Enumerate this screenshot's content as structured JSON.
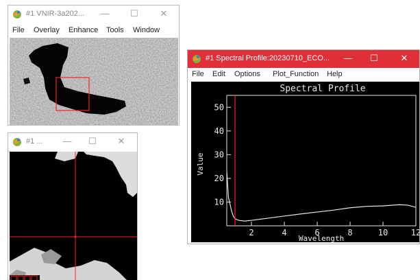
{
  "windows": {
    "image": {
      "title": "#1 VNIR-3a202...",
      "menu": [
        "File",
        "Overlay",
        "Enhance",
        "Tools",
        "Window"
      ]
    },
    "zoom": {
      "title": "#1 ..."
    },
    "spectral": {
      "title": "#1 Spectral Profile:20230710_ECO...",
      "menu": [
        "File",
        "Edit",
        "Options",
        "Plot_Function",
        "Help"
      ]
    }
  },
  "controls": {
    "minimize": "—",
    "maximize": "☐",
    "close": "✕"
  },
  "icons": {
    "app": "envi-globe-icon"
  },
  "colors": {
    "red_accent": "#e12f3a",
    "selection": "#ff2020",
    "plot_line": "#e8e8e8",
    "plot_bg": "#000000",
    "crosshair": "#ff2020"
  },
  "chart_data": {
    "type": "line",
    "title": "Spectral Profile",
    "xlabel": "Wavelength",
    "ylabel": "Value",
    "xlim": [
      0.5,
      12
    ],
    "ylim": [
      0,
      55
    ],
    "xticks": [
      2,
      4,
      6,
      8,
      10,
      12
    ],
    "yticks": [
      10,
      20,
      30,
      40,
      50
    ],
    "series": [
      {
        "x": [
          0.5,
          0.6,
          0.7,
          0.8,
          0.9,
          1.0,
          1.1,
          1.3,
          1.6,
          2,
          3,
          4,
          5,
          6,
          7,
          8,
          9,
          10,
          11,
          11.5,
          12
        ],
        "y": [
          23,
          12,
          9,
          6,
          4,
          3,
          2.6,
          2.2,
          2,
          2.3,
          3.2,
          4.1,
          5,
          5.8,
          6.6,
          7.6,
          8.2,
          8.4,
          8.9,
          8.7,
          7.8
        ],
        "color": "#e8e8e8"
      }
    ],
    "marker_x": 1.0
  }
}
